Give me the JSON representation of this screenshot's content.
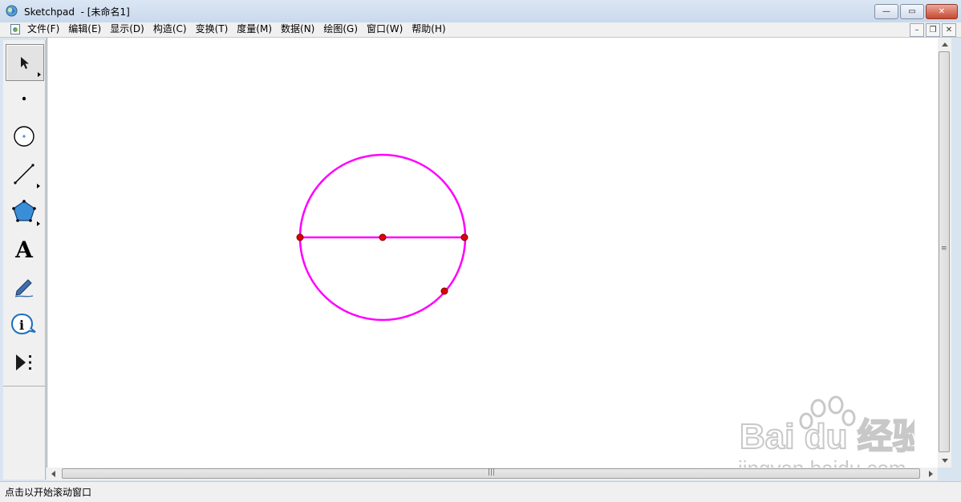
{
  "window": {
    "title": "Sketchpad  - [未命名1]",
    "controls": {
      "minimize": "—",
      "restore": "▭",
      "close": "✕"
    }
  },
  "menubar": {
    "items": [
      "文件(F)",
      "编辑(E)",
      "显示(D)",
      "构造(C)",
      "变换(T)",
      "度量(M)",
      "数据(N)",
      "绘图(G)",
      "窗口(W)",
      "帮助(H)"
    ],
    "doc_controls": {
      "minimize": "–",
      "restore": "❐",
      "close": "✕"
    }
  },
  "toolbox": {
    "tools": [
      {
        "name": "arrow-tool-icon",
        "selected": true
      },
      {
        "name": "point-tool-icon"
      },
      {
        "name": "compass-tool-icon"
      },
      {
        "name": "straightedge-tool-icon"
      },
      {
        "name": "polygon-tool-icon"
      },
      {
        "name": "text-tool-icon",
        "glyph": "A"
      },
      {
        "name": "marker-tool-icon"
      },
      {
        "name": "information-tool-icon",
        "glyph": "i"
      },
      {
        "name": "custom-tool-icon"
      }
    ]
  },
  "sketch": {
    "circle_color": "#ff00ff",
    "point_fill": "#e00000",
    "point_stroke": "#7a0000"
  },
  "watermark": {
    "brand": "Bai du 经验",
    "url": "jingyan.baidu.com"
  },
  "statusbar": {
    "text": "点击以开始滚动窗口"
  }
}
